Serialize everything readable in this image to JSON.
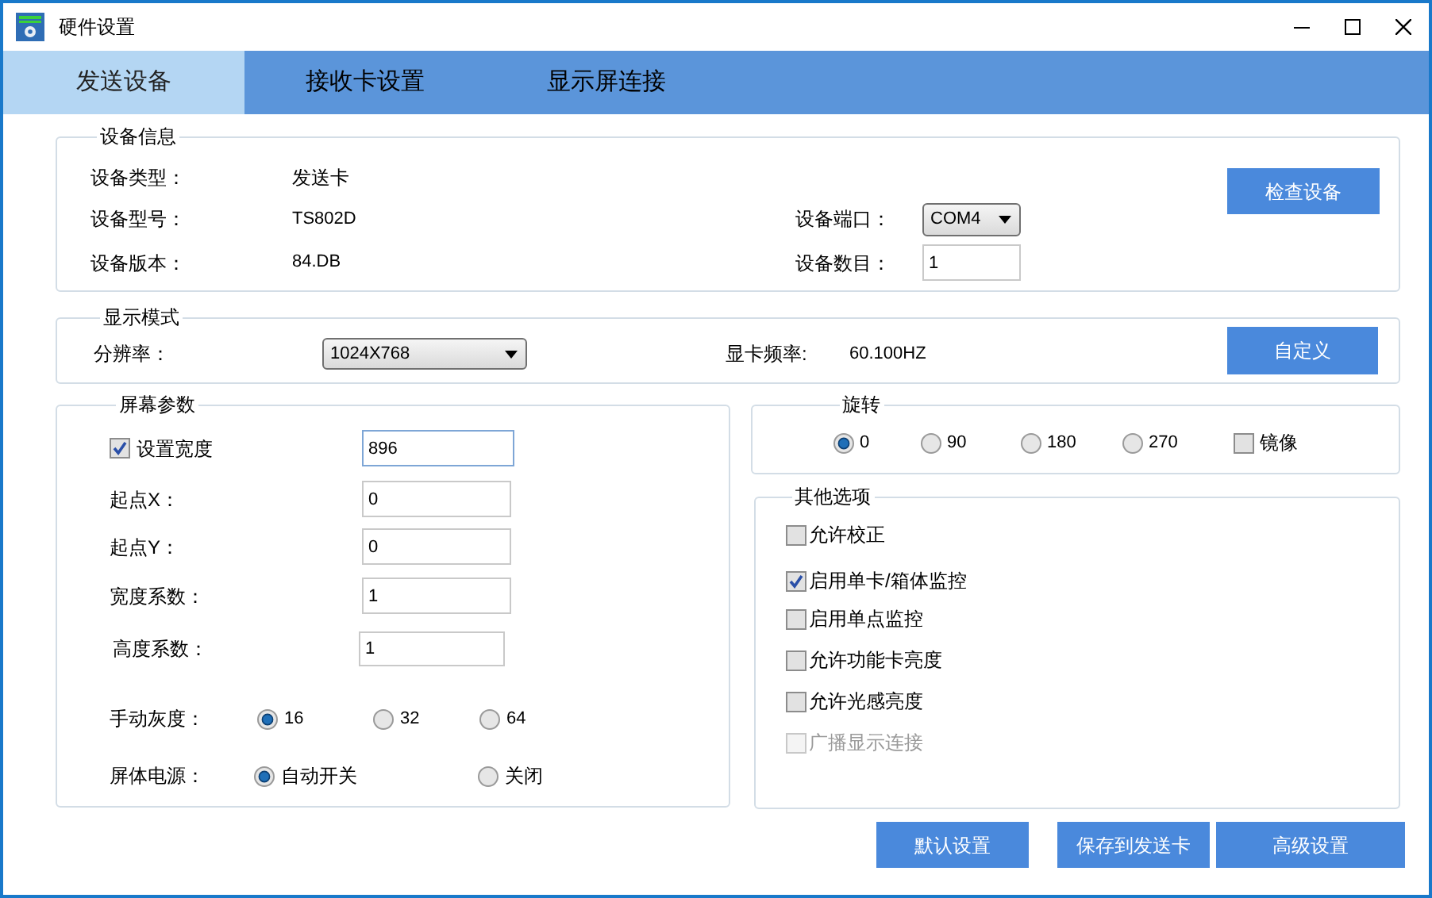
{
  "window": {
    "title": "硬件设置"
  },
  "tabs": [
    {
      "label": "发送设备",
      "selected": true
    },
    {
      "label": "接收卡设置",
      "selected": false
    },
    {
      "label": "显示屏连接",
      "selected": false
    }
  ],
  "device_info": {
    "title": "设备信息",
    "rows": [
      {
        "label": "设备类型：",
        "value": "发送卡"
      },
      {
        "label": "设备型号：",
        "value": "TS802D"
      },
      {
        "label": "设备版本：",
        "value": "84.DB"
      }
    ],
    "port": {
      "label": "设备端口：",
      "value": "COM4"
    },
    "count": {
      "label": "设备数目：",
      "value": "1"
    },
    "button": "检查设备"
  },
  "display_mode": {
    "title": "显示模式",
    "resolution": {
      "label": "分辨率：",
      "value": "1024X768"
    },
    "frequency": {
      "label": "显卡频率:",
      "value": "60.100HZ"
    },
    "button": "自定义"
  },
  "screen_params": {
    "title": "屏幕参数",
    "fields": [
      {
        "kind": "checkbox",
        "label": "设置宽度",
        "checked": true,
        "value": "896",
        "focused": true
      },
      {
        "kind": "label",
        "label": "起点X：",
        "value": "0",
        "focused": false
      },
      {
        "kind": "label",
        "label": "起点Y：",
        "value": "0",
        "focused": false
      },
      {
        "kind": "label",
        "label": "宽度系数：",
        "value": "1",
        "focused": false
      },
      {
        "kind": "label",
        "label": "高度系数：",
        "value": "1",
        "focused": false
      }
    ],
    "radio_groups": [
      {
        "label": "手动灰度：",
        "options": [
          {
            "label": "16",
            "selected": true
          },
          {
            "label": "32",
            "selected": false
          },
          {
            "label": "64",
            "selected": false
          }
        ]
      },
      {
        "label": "屏体电源：",
        "options": [
          {
            "label": "自动开关",
            "selected": true
          },
          {
            "label": "关闭",
            "selected": false
          }
        ]
      }
    ]
  },
  "rotation": {
    "title": "旋转",
    "options": [
      {
        "label": "0",
        "selected": true
      },
      {
        "label": "90",
        "selected": false
      },
      {
        "label": "180",
        "selected": false
      },
      {
        "label": "270",
        "selected": false
      }
    ],
    "mirror": {
      "label": "镜像",
      "checked": false
    }
  },
  "other_options": {
    "title": "其他选项",
    "items": [
      {
        "label": "允许校正",
        "checked": false,
        "disabled": false
      },
      {
        "label": "启用单卡/箱体监控",
        "checked": true,
        "disabled": false
      },
      {
        "label": "启用单点监控",
        "checked": false,
        "disabled": false
      },
      {
        "label": "允许功能卡亮度",
        "checked": false,
        "disabled": false
      },
      {
        "label": "允许光感亮度",
        "checked": false,
        "disabled": false
      },
      {
        "label": "广播显示连接",
        "checked": false,
        "disabled": true
      }
    ]
  },
  "buttons": [
    "默认设置",
    "保存到发送卡",
    "高级设置"
  ]
}
